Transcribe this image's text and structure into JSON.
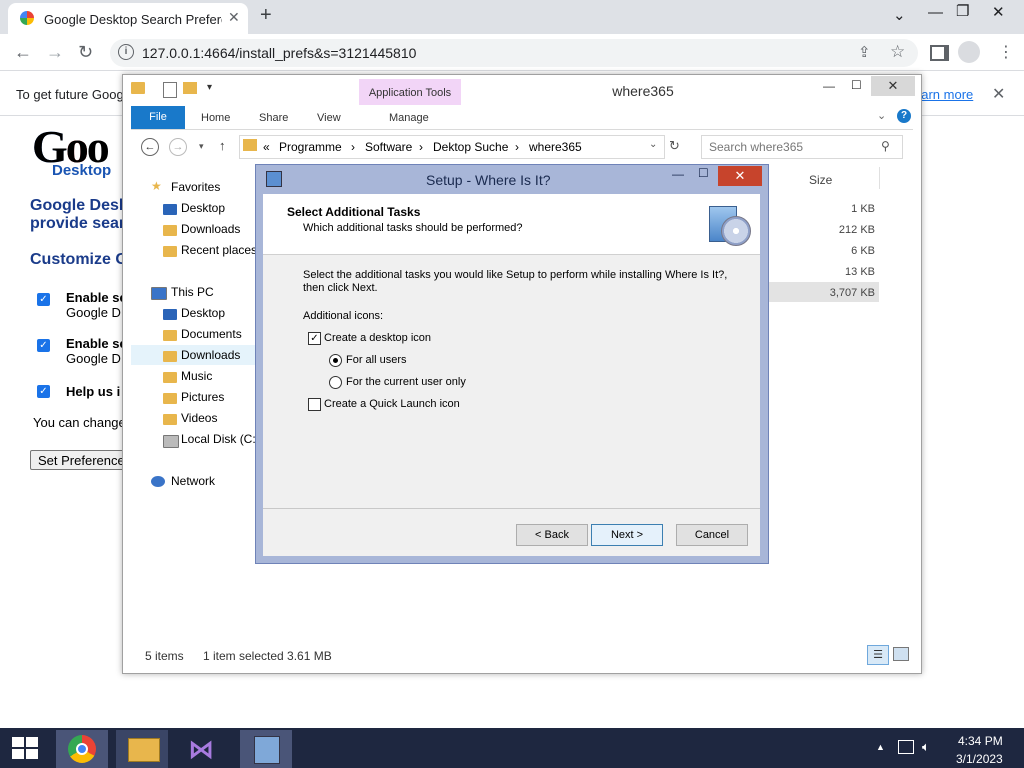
{
  "browser": {
    "tab_title": "Google Desktop Search Preferen",
    "url": "127.0.0.1:4664/install_prefs&s=3121445810",
    "infobar_text": "To get future Goog",
    "learn_more": "earn more"
  },
  "page": {
    "logo_text": "Goo",
    "logo_sub": "Desktop",
    "heading1_line1": "Google Desk",
    "heading1_line2": "provide sear",
    "heading2": "Customize G",
    "opt1_line1": "Enable se",
    "opt1_line2": "Google D",
    "opt2_line1": "Enable se",
    "opt2_line2": "Google D",
    "opt3": "Help us i",
    "note": "You can change",
    "button": "Set Preference"
  },
  "explorer": {
    "title": "where365",
    "app_tools": "Application Tools",
    "tabs": {
      "file": "File",
      "home": "Home",
      "share": "Share",
      "view": "View",
      "manage": "Manage"
    },
    "breadcrumb": [
      "«",
      "Programme",
      "›",
      "Software",
      "›",
      "Dektop Suche",
      "›",
      "where365"
    ],
    "search_placeholder": "Search where365",
    "col_size": "Size",
    "nav": {
      "favorites": "Favorites",
      "fav_items": [
        "Desktop",
        "Downloads",
        "Recent places"
      ],
      "this_pc": "This PC",
      "pc_items": [
        "Desktop",
        "Documents",
        "Downloads",
        "Music",
        "Pictures",
        "Videos",
        "Local Disk (C:)"
      ],
      "network": "Network"
    },
    "sizes": [
      "1 KB",
      "212 KB",
      "6 KB",
      "13 KB",
      "3,707 KB"
    ],
    "status_items": "5 items",
    "status_selected": "1 item selected  3.61 MB"
  },
  "dialog": {
    "title": "Setup - Where Is It?",
    "header_title": "Select Additional Tasks",
    "header_subtitle": "Which additional tasks should be performed?",
    "instruction_line1": "Select the additional tasks you would like Setup to perform while installing Where Is It?,",
    "instruction_line2": "then click Next.",
    "group_label": "Additional icons:",
    "cb_desktop": "Create a desktop icon",
    "radio_all": "For all users",
    "radio_current": "For the current user only",
    "cb_quicklaunch": "Create a Quick Launch icon",
    "btn_back": "< Back",
    "btn_next": "Next >",
    "btn_cancel": "Cancel"
  },
  "taskbar": {
    "time": "4:34 PM",
    "date": "3/1/2023"
  }
}
